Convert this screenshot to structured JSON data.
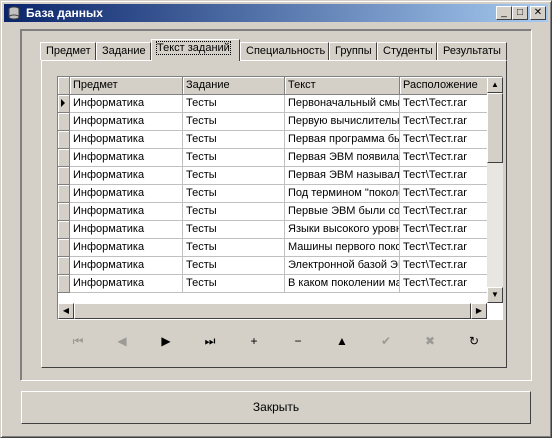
{
  "window": {
    "title": "База данных",
    "minimize": "_",
    "maximize": "□",
    "close": "✕"
  },
  "tabs": [
    "Предмет",
    "Задание",
    "Текст заданий",
    "Специальность",
    "Группы",
    "Студенты",
    "Результаты"
  ],
  "active_tab": "Текст заданий",
  "grid": {
    "columns": [
      "Предмет",
      "Задание",
      "Текст",
      "Расположение"
    ],
    "rows": [
      [
        "Информатика",
        "Тесты",
        "Первоначальный смысл",
        "Тест\\Тест.rar"
      ],
      [
        "Информатика",
        "Тесты",
        "Первую вычислительную",
        "Тест\\Тест.rar"
      ],
      [
        "Информатика",
        "Тесты",
        "Первая программа была",
        "Тест\\Тест.rar"
      ],
      [
        "Информатика",
        "Тесты",
        "Первая ЭВМ появилась",
        "Тест\\Тест.rar"
      ],
      [
        "Информатика",
        "Тесты",
        "Первая ЭВМ называлась",
        "Тест\\Тест.rar"
      ],
      [
        "Информатика",
        "Тесты",
        "Под термином \"поколение",
        "Тест\\Тест.rar"
      ],
      [
        "Информатика",
        "Тесты",
        "Первые ЭВМ были созданы",
        "Тест\\Тест.rar"
      ],
      [
        "Информатика",
        "Тесты",
        "Языки высокого уровня",
        "Тест\\Тест.rar"
      ],
      [
        "Информатика",
        "Тесты",
        "Машины первого поколения",
        "Тест\\Тест.rar"
      ],
      [
        "Информатика",
        "Тесты",
        "Электронной базой ЭВМ",
        "Тест\\Тест.rar"
      ],
      [
        "Информатика",
        "Тесты",
        "В каком поколении машин",
        "Тест\\Тест.rar"
      ]
    ]
  },
  "navigator": [
    {
      "name": "first-record-button",
      "glyph": "⏮",
      "enabled": false
    },
    {
      "name": "prior-record-button",
      "glyph": "◀",
      "enabled": false
    },
    {
      "name": "next-record-button",
      "glyph": "▶",
      "enabled": true
    },
    {
      "name": "last-record-button",
      "glyph": "⏭",
      "enabled": true
    },
    {
      "name": "insert-record-button",
      "glyph": "+",
      "enabled": true
    },
    {
      "name": "delete-record-button",
      "glyph": "−",
      "enabled": true
    },
    {
      "name": "edit-record-button",
      "glyph": "▲",
      "enabled": true
    },
    {
      "name": "post-edit-button",
      "glyph": "✔",
      "enabled": false
    },
    {
      "name": "cancel-edit-button",
      "glyph": "✖",
      "enabled": false
    },
    {
      "name": "refresh-data-button",
      "glyph": "↻",
      "enabled": true
    }
  ],
  "close_button": "Закрыть"
}
